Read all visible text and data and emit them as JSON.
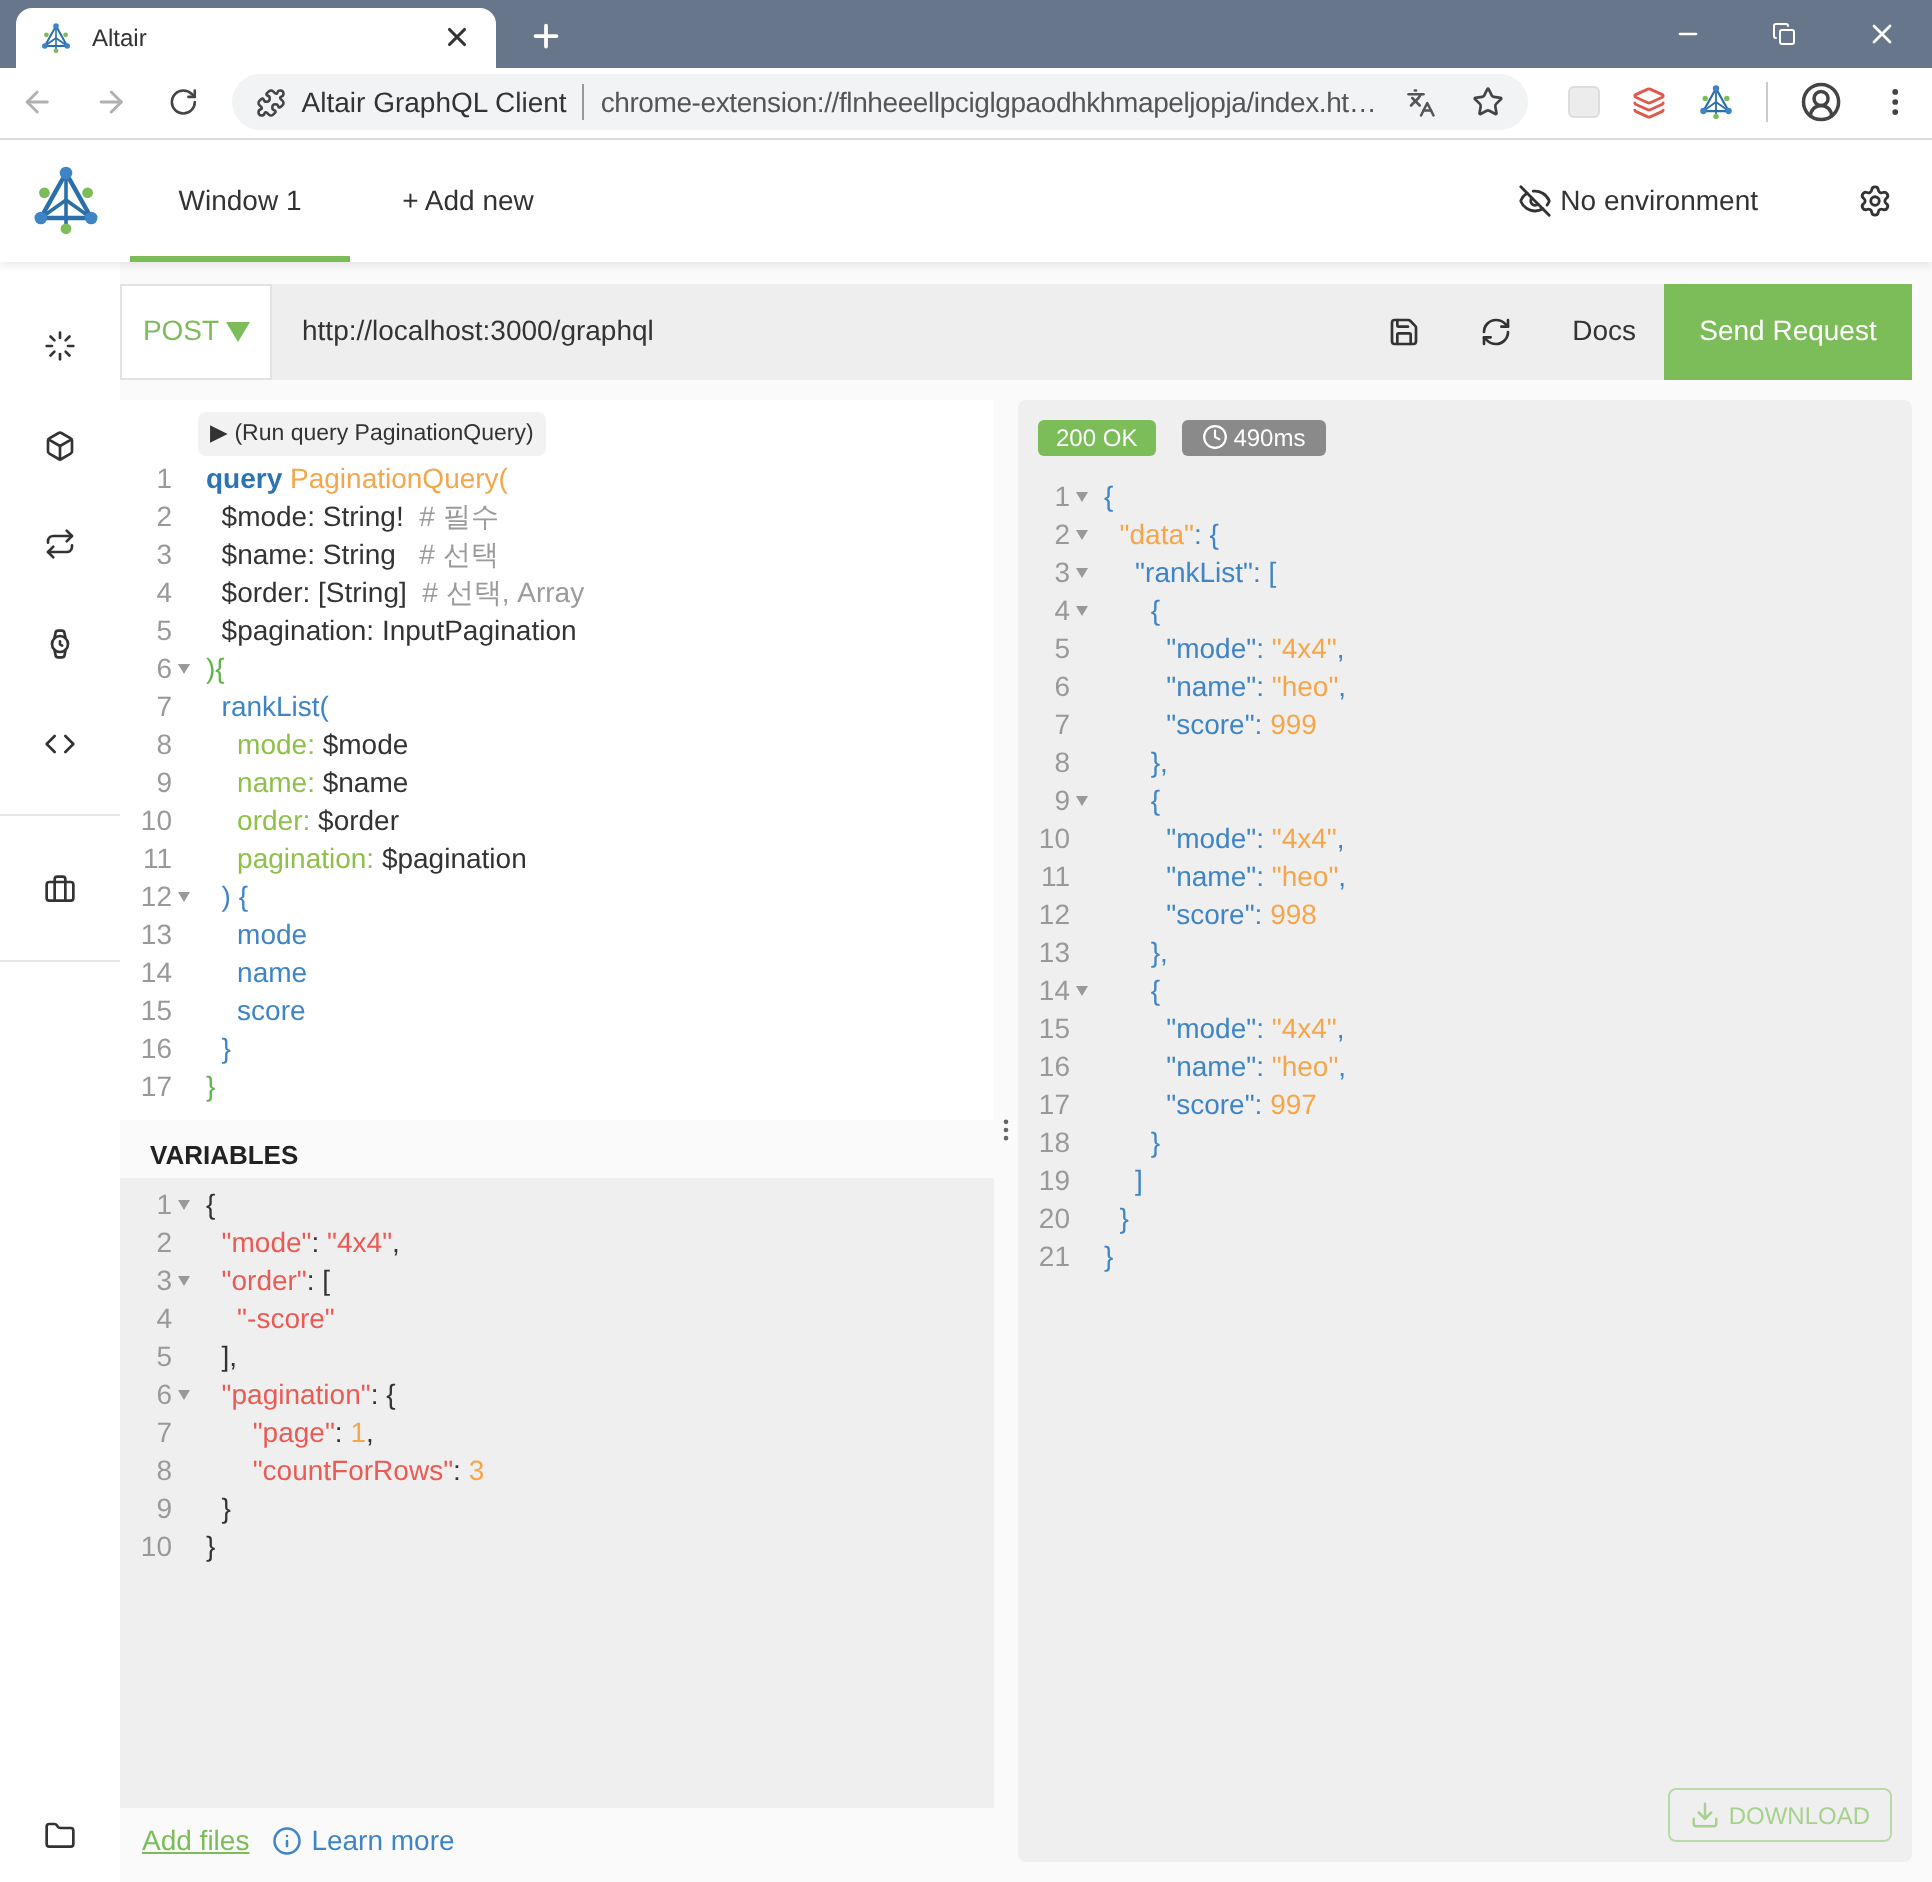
{
  "browser": {
    "tab": {
      "title": "Altair"
    },
    "omnibox": {
      "site": "Altair GraphQL Client",
      "url": "chrome-extension://flnheeellpciglgpaodhkhmapeljopja/index.ht…"
    }
  },
  "header": {
    "tabs": [
      {
        "label": "Window 1",
        "selected": true
      },
      {
        "label": "+ Add new",
        "selected": false
      }
    ],
    "environment": "No environment"
  },
  "request": {
    "method": "POST",
    "url": "http://localhost:3000/graphql",
    "docs": "Docs",
    "send": "Send Request"
  },
  "query_editor": {
    "run_hint": "▶ (Run query PaginationQuery)",
    "lines": [
      {
        "number": "1",
        "foldable": false,
        "tokens": [
          {
            "kind": "keyword",
            "text": "query"
          },
          {
            "kind": "definition",
            "text": " PaginationQuery("
          }
        ]
      },
      {
        "number": "2",
        "foldable": false,
        "tokens": [
          {
            "kind": "variable",
            "text": "  $mode: String!"
          },
          {
            "kind": "comment",
            "text": "  # 필수"
          }
        ]
      },
      {
        "number": "3",
        "foldable": false,
        "tokens": [
          {
            "kind": "variable",
            "text": "  $name: String"
          },
          {
            "kind": "comment",
            "text": "   # 선택"
          }
        ]
      },
      {
        "number": "4",
        "foldable": false,
        "tokens": [
          {
            "kind": "variable",
            "text": "  $order: [String]"
          },
          {
            "kind": "comment",
            "text": "  # 선택, Array"
          }
        ]
      },
      {
        "number": "5",
        "foldable": false,
        "tokens": [
          {
            "kind": "variable",
            "text": "  $pagination: InputPagination"
          }
        ]
      },
      {
        "number": "6",
        "foldable": true,
        "tokens": [
          {
            "kind": "bracket",
            "text": "){"
          }
        ]
      },
      {
        "number": "7",
        "foldable": false,
        "tokens": [
          {
            "kind": "field",
            "text": "  rankList("
          }
        ]
      },
      {
        "number": "8",
        "foldable": false,
        "tokens": [
          {
            "kind": "argument",
            "text": "    mode:"
          },
          {
            "kind": "variable",
            "text": " $mode"
          }
        ]
      },
      {
        "number": "9",
        "foldable": false,
        "tokens": [
          {
            "kind": "argument",
            "text": "    name:"
          },
          {
            "kind": "variable",
            "text": " $name"
          }
        ]
      },
      {
        "number": "10",
        "foldable": false,
        "tokens": [
          {
            "kind": "argument",
            "text": "    order:"
          },
          {
            "kind": "variable",
            "text": " $order"
          }
        ]
      },
      {
        "number": "11",
        "foldable": false,
        "tokens": [
          {
            "kind": "argument",
            "text": "    pagination:"
          },
          {
            "kind": "variable",
            "text": " $pagination"
          }
        ]
      },
      {
        "number": "12",
        "foldable": true,
        "tokens": [
          {
            "kind": "field",
            "text": "  ) {"
          }
        ]
      },
      {
        "number": "13",
        "foldable": false,
        "tokens": [
          {
            "kind": "field",
            "text": "    mode"
          }
        ]
      },
      {
        "number": "14",
        "foldable": false,
        "tokens": [
          {
            "kind": "field",
            "text": "    name"
          }
        ]
      },
      {
        "number": "15",
        "foldable": false,
        "tokens": [
          {
            "kind": "field",
            "text": "    score"
          }
        ]
      },
      {
        "number": "16",
        "foldable": false,
        "tokens": [
          {
            "kind": "field",
            "text": "  }"
          }
        ]
      },
      {
        "number": "17",
        "foldable": false,
        "tokens": [
          {
            "kind": "bracket",
            "text": "}"
          }
        ]
      }
    ]
  },
  "variables": {
    "title": "VARIABLES",
    "lines": [
      {
        "number": "1",
        "foldable": true,
        "tokens": [
          {
            "kind": "plain",
            "text": "{"
          }
        ]
      },
      {
        "number": "2",
        "foldable": false,
        "tokens": [
          {
            "kind": "key",
            "text": "  \"mode\""
          },
          {
            "kind": "plain",
            "text": ": "
          },
          {
            "kind": "string",
            "text": "\"4x4\""
          },
          {
            "kind": "plain",
            "text": ","
          }
        ]
      },
      {
        "number": "3",
        "foldable": true,
        "tokens": [
          {
            "kind": "key",
            "text": "  \"order\""
          },
          {
            "kind": "plain",
            "text": ": ["
          }
        ]
      },
      {
        "number": "4",
        "foldable": false,
        "tokens": [
          {
            "kind": "string",
            "text": "    \"-score\""
          }
        ]
      },
      {
        "number": "5",
        "foldable": false,
        "tokens": [
          {
            "kind": "plain",
            "text": "  ],"
          }
        ]
      },
      {
        "number": "6",
        "foldable": true,
        "tokens": [
          {
            "kind": "key",
            "text": "  \"pagination\""
          },
          {
            "kind": "plain",
            "text": ": {"
          }
        ]
      },
      {
        "number": "7",
        "foldable": false,
        "tokens": [
          {
            "kind": "key",
            "text": "      \"page\""
          },
          {
            "kind": "plain",
            "text": ": "
          },
          {
            "kind": "number",
            "text": "1"
          },
          {
            "kind": "plain",
            "text": ","
          }
        ]
      },
      {
        "number": "8",
        "foldable": false,
        "tokens": [
          {
            "kind": "key",
            "text": "      \"countForRows\""
          },
          {
            "kind": "plain",
            "text": ": "
          },
          {
            "kind": "number",
            "text": "3"
          }
        ]
      },
      {
        "number": "9",
        "foldable": false,
        "tokens": [
          {
            "kind": "plain",
            "text": "  }"
          }
        ]
      },
      {
        "number": "10",
        "foldable": false,
        "tokens": [
          {
            "kind": "plain",
            "text": "}"
          }
        ]
      }
    ]
  },
  "footer": {
    "add_files": "Add files",
    "learn_more": "Learn more"
  },
  "response": {
    "status": "200 OK",
    "time": "490ms",
    "download": "DOWNLOAD",
    "lines": [
      {
        "number": "1",
        "foldable": true,
        "tokens": [
          {
            "kind": "plain",
            "text": "{"
          }
        ]
      },
      {
        "number": "2",
        "foldable": true,
        "tokens": [
          {
            "kind": "root-key",
            "text": "  \"data\""
          },
          {
            "kind": "plain",
            "text": ": {"
          }
        ]
      },
      {
        "number": "3",
        "foldable": true,
        "tokens": [
          {
            "kind": "key",
            "text": "    \"rankList\""
          },
          {
            "kind": "plain",
            "text": ": ["
          }
        ]
      },
      {
        "number": "4",
        "foldable": true,
        "tokens": [
          {
            "kind": "plain",
            "text": "      {"
          }
        ]
      },
      {
        "number": "5",
        "foldable": false,
        "tokens": [
          {
            "kind": "key",
            "text": "        \"mode\""
          },
          {
            "kind": "plain",
            "text": ": "
          },
          {
            "kind": "string",
            "text": "\"4x4\""
          },
          {
            "kind": "plain",
            "text": ","
          }
        ]
      },
      {
        "number": "6",
        "foldable": false,
        "tokens": [
          {
            "kind": "key",
            "text": "        \"name\""
          },
          {
            "kind": "plain",
            "text": ": "
          },
          {
            "kind": "string",
            "text": "\"heo\""
          },
          {
            "kind": "plain",
            "text": ","
          }
        ]
      },
      {
        "number": "7",
        "foldable": false,
        "tokens": [
          {
            "kind": "key",
            "text": "        \"score\""
          },
          {
            "kind": "plain",
            "text": ": "
          },
          {
            "kind": "number",
            "text": "999"
          }
        ]
      },
      {
        "number": "8",
        "foldable": false,
        "tokens": [
          {
            "kind": "plain",
            "text": "      },"
          }
        ]
      },
      {
        "number": "9",
        "foldable": true,
        "tokens": [
          {
            "kind": "plain",
            "text": "      {"
          }
        ]
      },
      {
        "number": "10",
        "foldable": false,
        "tokens": [
          {
            "kind": "key",
            "text": "        \"mode\""
          },
          {
            "kind": "plain",
            "text": ": "
          },
          {
            "kind": "string",
            "text": "\"4x4\""
          },
          {
            "kind": "plain",
            "text": ","
          }
        ]
      },
      {
        "number": "11",
        "foldable": false,
        "tokens": [
          {
            "kind": "key",
            "text": "        \"name\""
          },
          {
            "kind": "plain",
            "text": ": "
          },
          {
            "kind": "string",
            "text": "\"heo\""
          },
          {
            "kind": "plain",
            "text": ","
          }
        ]
      },
      {
        "number": "12",
        "foldable": false,
        "tokens": [
          {
            "kind": "key",
            "text": "        \"score\""
          },
          {
            "kind": "plain",
            "text": ": "
          },
          {
            "kind": "number",
            "text": "998"
          }
        ]
      },
      {
        "number": "13",
        "foldable": false,
        "tokens": [
          {
            "kind": "plain",
            "text": "      },"
          }
        ]
      },
      {
        "number": "14",
        "foldable": true,
        "tokens": [
          {
            "kind": "plain",
            "text": "      {"
          }
        ]
      },
      {
        "number": "15",
        "foldable": false,
        "tokens": [
          {
            "kind": "key",
            "text": "        \"mode\""
          },
          {
            "kind": "plain",
            "text": ": "
          },
          {
            "kind": "string",
            "text": "\"4x4\""
          },
          {
            "kind": "plain",
            "text": ","
          }
        ]
      },
      {
        "number": "16",
        "foldable": false,
        "tokens": [
          {
            "kind": "key",
            "text": "        \"name\""
          },
          {
            "kind": "plain",
            "text": ": "
          },
          {
            "kind": "string",
            "text": "\"heo\""
          },
          {
            "kind": "plain",
            "text": ","
          }
        ]
      },
      {
        "number": "17",
        "foldable": false,
        "tokens": [
          {
            "kind": "key",
            "text": "        \"score\""
          },
          {
            "kind": "plain",
            "text": ": "
          },
          {
            "kind": "number",
            "text": "997"
          }
        ]
      },
      {
        "number": "18",
        "foldable": false,
        "tokens": [
          {
            "kind": "plain",
            "text": "      }"
          }
        ]
      },
      {
        "number": "19",
        "foldable": false,
        "tokens": [
          {
            "kind": "plain",
            "text": "    ]"
          }
        ]
      },
      {
        "number": "20",
        "foldable": false,
        "tokens": [
          {
            "kind": "plain",
            "text": "  }"
          }
        ]
      },
      {
        "number": "21",
        "foldable": false,
        "tokens": [
          {
            "kind": "plain",
            "text": "}"
          }
        ]
      }
    ]
  }
}
